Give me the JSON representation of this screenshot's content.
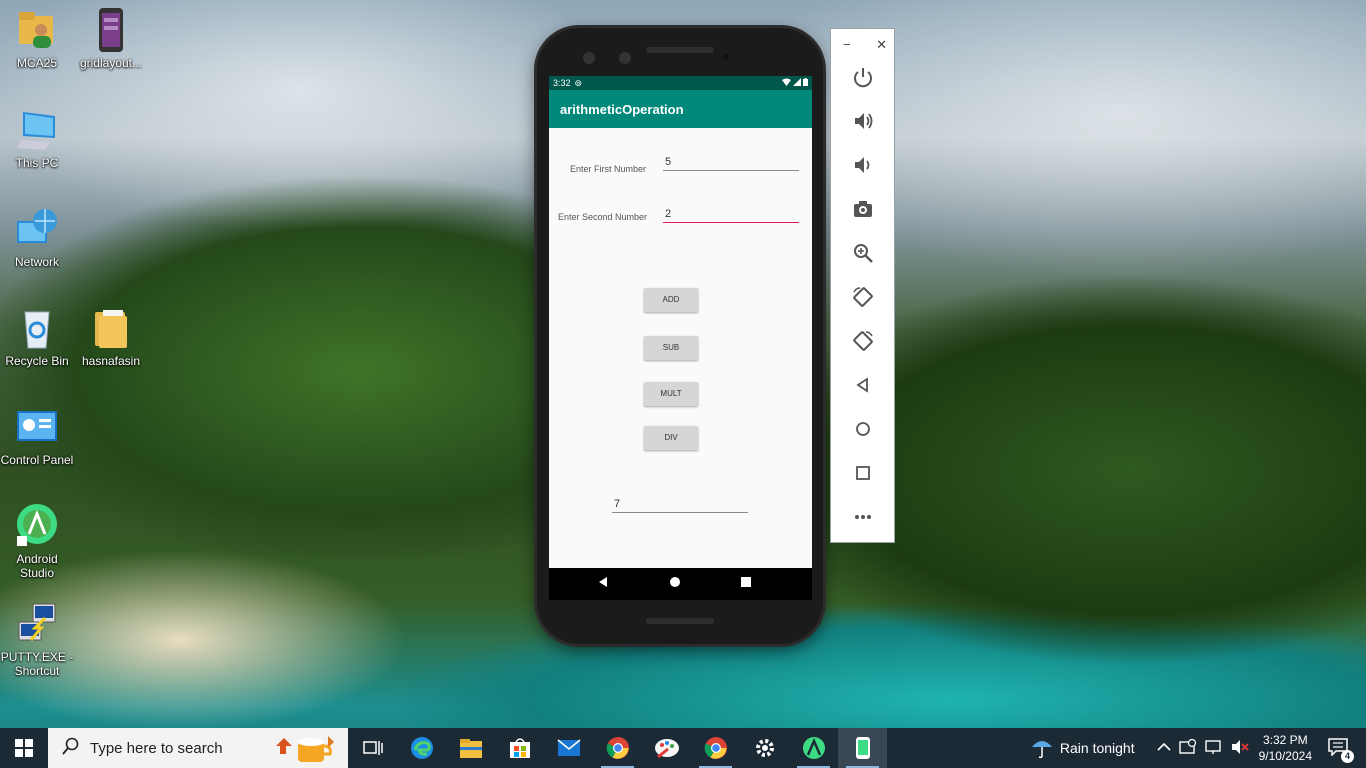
{
  "desktop": {
    "icons": [
      {
        "label": "MCA25",
        "icon": "user-folder-icon"
      },
      {
        "label": "gridlayout...",
        "icon": "app-file-icon"
      },
      {
        "label": "This PC",
        "icon": "computer-icon"
      },
      {
        "label": "Network",
        "icon": "network-icon"
      },
      {
        "label": "Recycle Bin",
        "icon": "recycle-bin-icon"
      },
      {
        "label": "hasnafasin",
        "icon": "folder-icon"
      },
      {
        "label": "Control Panel",
        "icon": "control-panel-icon"
      },
      {
        "label": "Android Studio",
        "icon": "android-studio-icon"
      },
      {
        "label": "PUTTY.EXE - Shortcut",
        "icon": "putty-icon"
      }
    ]
  },
  "emulator": {
    "status_bar": {
      "time": "3:32"
    },
    "app_title": "arithmeticOperation",
    "form": {
      "first_label": "Enter First Number",
      "first_value": "5",
      "second_label": "Enter Second Number",
      "second_value": "2"
    },
    "buttons": [
      "ADD",
      "SUB",
      "MULT",
      "DIV"
    ],
    "result_value": "7",
    "toolbar": {
      "window_minimize": "−",
      "window_close": "✕",
      "controls": [
        "power-icon",
        "volume-up-icon",
        "volume-down-icon",
        "camera-icon",
        "zoom-icon",
        "rotate-left-icon",
        "rotate-right-icon",
        "back-icon",
        "home-icon",
        "overview-icon",
        "more-icon"
      ]
    }
  },
  "taskbar": {
    "search_placeholder": "Type here to search",
    "pinned_apps": [
      "task-view-icon",
      "edge-icon",
      "file-explorer-icon",
      "store-icon",
      "mail-icon",
      "chrome-icon",
      "paint-icon",
      "chrome-icon",
      "settings-icon",
      "android-studio-icon",
      "emulator-icon"
    ],
    "weather": "Rain tonight",
    "time": "3:32 PM",
    "date": "9/10/2024",
    "notification_count": "4"
  },
  "colors": {
    "app_bar": "#00897b",
    "status_bar": "#00574b",
    "focus_underline": "#d81b60",
    "taskbar": "#1c2a36"
  }
}
